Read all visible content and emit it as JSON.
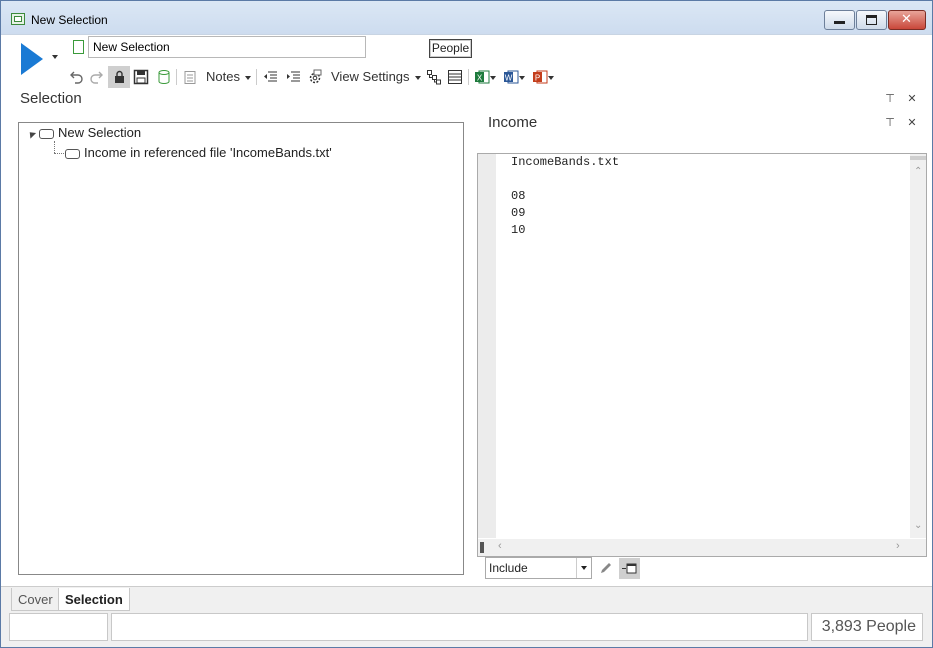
{
  "window": {
    "title": "New Selection"
  },
  "toolbar": {
    "selection_name": "New Selection",
    "people_label": "People",
    "notes_label": "Notes",
    "view_settings_label": "View Settings"
  },
  "selection_panel": {
    "title": "Selection",
    "tree": [
      {
        "label": "New Selection"
      },
      {
        "label": "Income in referenced file 'IncomeBands.txt'"
      }
    ]
  },
  "income_panel": {
    "title": "Income",
    "lines": [
      "IncomeBands.txt",
      "",
      "08",
      "09",
      "10"
    ],
    "mode_value": "Include"
  },
  "tabs": [
    {
      "label": "Cover"
    },
    {
      "label": "Selection"
    }
  ],
  "status": {
    "count": "3,893 People"
  },
  "icons": {
    "run": "play-icon",
    "undo": "undo-icon",
    "redo": "redo-icon",
    "lock": "lock-icon",
    "save": "save-icon",
    "excel": "excel-icon",
    "word": "word-icon",
    "powerpoint": "powerpoint-icon"
  },
  "colors": {
    "accent": "#1a7ad4",
    "excel": "#1d7a3c",
    "word": "#2b5797",
    "powerpoint": "#c43e1c"
  }
}
